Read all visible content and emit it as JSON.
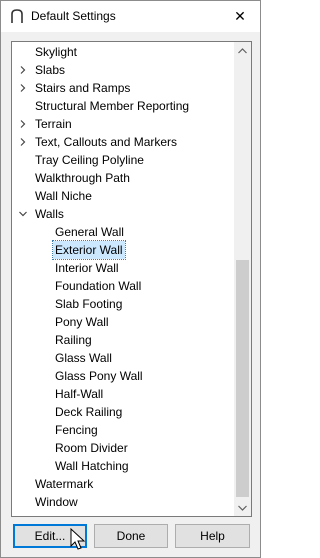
{
  "window": {
    "title": "Default Settings",
    "close_symbol": "✕"
  },
  "tree": {
    "items": [
      {
        "label": "Skylight",
        "expander": "none",
        "level": 0
      },
      {
        "label": "Slabs",
        "expander": "collapsed",
        "level": 0
      },
      {
        "label": "Stairs and Ramps",
        "expander": "collapsed",
        "level": 0
      },
      {
        "label": "Structural Member Reporting",
        "expander": "none",
        "level": 0
      },
      {
        "label": "Terrain",
        "expander": "collapsed",
        "level": 0
      },
      {
        "label": "Text, Callouts and Markers",
        "expander": "collapsed",
        "level": 0
      },
      {
        "label": "Tray Ceiling Polyline",
        "expander": "none",
        "level": 0
      },
      {
        "label": "Walkthrough Path",
        "expander": "none",
        "level": 0
      },
      {
        "label": "Wall Niche",
        "expander": "none",
        "level": 0
      },
      {
        "label": "Walls",
        "expander": "expanded",
        "level": 0
      },
      {
        "label": "General Wall",
        "expander": "none",
        "level": 1
      },
      {
        "label": "Exterior Wall",
        "expander": "none",
        "level": 1,
        "selected": true
      },
      {
        "label": "Interior Wall",
        "expander": "none",
        "level": 1
      },
      {
        "label": "Foundation Wall",
        "expander": "none",
        "level": 1
      },
      {
        "label": "Slab Footing",
        "expander": "none",
        "level": 1
      },
      {
        "label": "Pony Wall",
        "expander": "none",
        "level": 1
      },
      {
        "label": "Railing",
        "expander": "none",
        "level": 1
      },
      {
        "label": "Glass Wall",
        "expander": "none",
        "level": 1
      },
      {
        "label": "Glass Pony Wall",
        "expander": "none",
        "level": 1
      },
      {
        "label": "Half-Wall",
        "expander": "none",
        "level": 1
      },
      {
        "label": "Deck Railing",
        "expander": "none",
        "level": 1
      },
      {
        "label": "Fencing",
        "expander": "none",
        "level": 1
      },
      {
        "label": "Room Divider",
        "expander": "none",
        "level": 1
      },
      {
        "label": "Wall Hatching",
        "expander": "none",
        "level": 1
      },
      {
        "label": "Watermark",
        "expander": "none",
        "level": 0
      },
      {
        "label": "Window",
        "expander": "none",
        "level": 0
      }
    ]
  },
  "buttons": {
    "edit": "Edit...",
    "done": "Done",
    "help": "Help"
  },
  "colors": {
    "selection_bg": "#cce8ff",
    "focus_border": "#0078d7"
  }
}
